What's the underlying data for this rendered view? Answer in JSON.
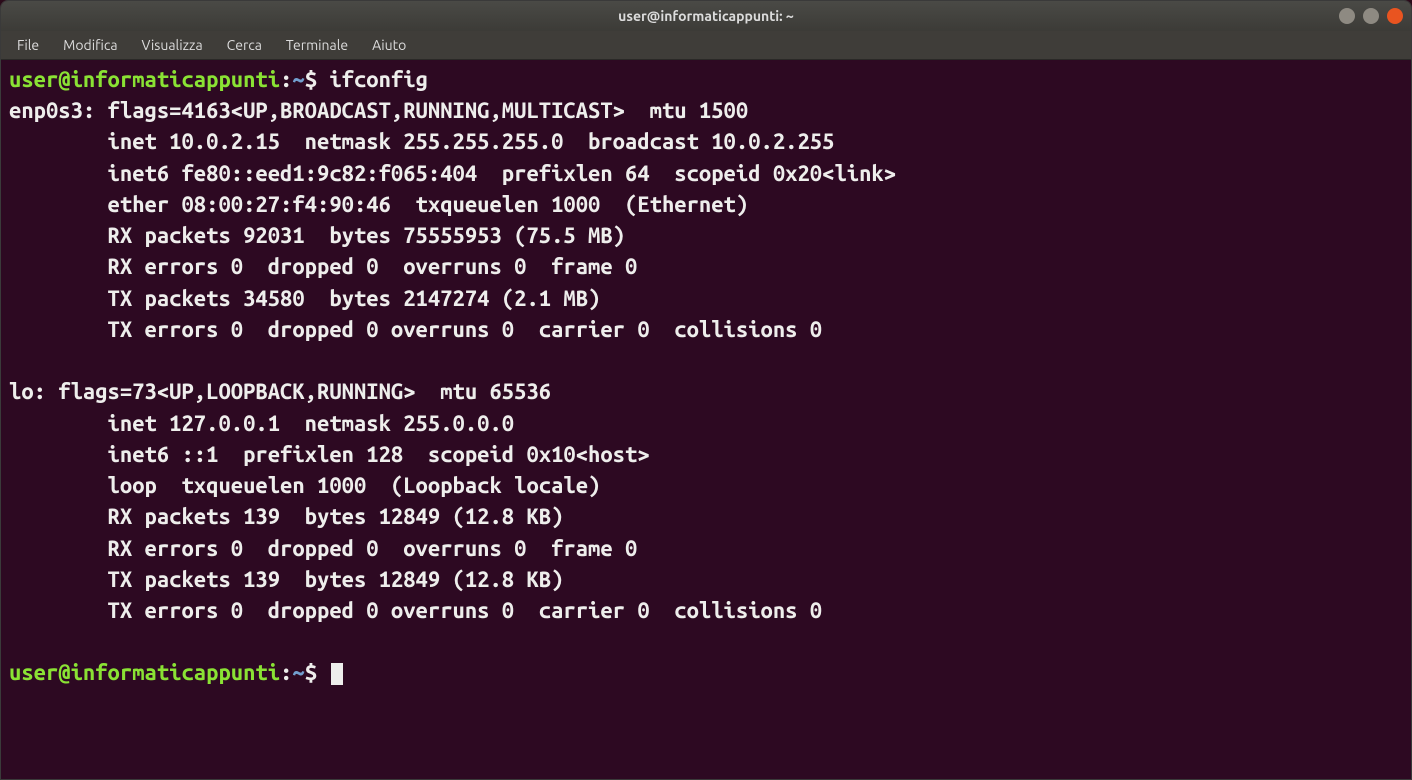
{
  "window": {
    "title": "user@informaticappunti: ~"
  },
  "menu": {
    "items": [
      "File",
      "Modifica",
      "Visualizza",
      "Cerca",
      "Terminale",
      "Aiuto"
    ]
  },
  "prompt": {
    "userhost": "user@informaticappunti",
    "colon": ":",
    "path": "~",
    "dollar": "$ "
  },
  "session": {
    "command": "ifconfig",
    "output_lines": [
      "enp0s3: flags=4163<UP,BROADCAST,RUNNING,MULTICAST>  mtu 1500",
      "        inet 10.0.2.15  netmask 255.255.255.0  broadcast 10.0.2.255",
      "        inet6 fe80::eed1:9c82:f065:404  prefixlen 64  scopeid 0x20<link>",
      "        ether 08:00:27:f4:90:46  txqueuelen 1000  (Ethernet)",
      "        RX packets 92031  bytes 75555953 (75.5 MB)",
      "        RX errors 0  dropped 0  overruns 0  frame 0",
      "        TX packets 34580  bytes 2147274 (2.1 MB)",
      "        TX errors 0  dropped 0 overruns 0  carrier 0  collisions 0",
      "",
      "lo: flags=73<UP,LOOPBACK,RUNNING>  mtu 65536",
      "        inet 127.0.0.1  netmask 255.0.0.0",
      "        inet6 ::1  prefixlen 128  scopeid 0x10<host>",
      "        loop  txqueuelen 1000  (Loopback locale)",
      "        RX packets 139  bytes 12849 (12.8 KB)",
      "        RX errors 0  dropped 0  overruns 0  frame 0",
      "        TX packets 139  bytes 12849 (12.8 KB)",
      "        TX errors 0  dropped 0 overruns 0  carrier 0  collisions 0",
      ""
    ]
  }
}
